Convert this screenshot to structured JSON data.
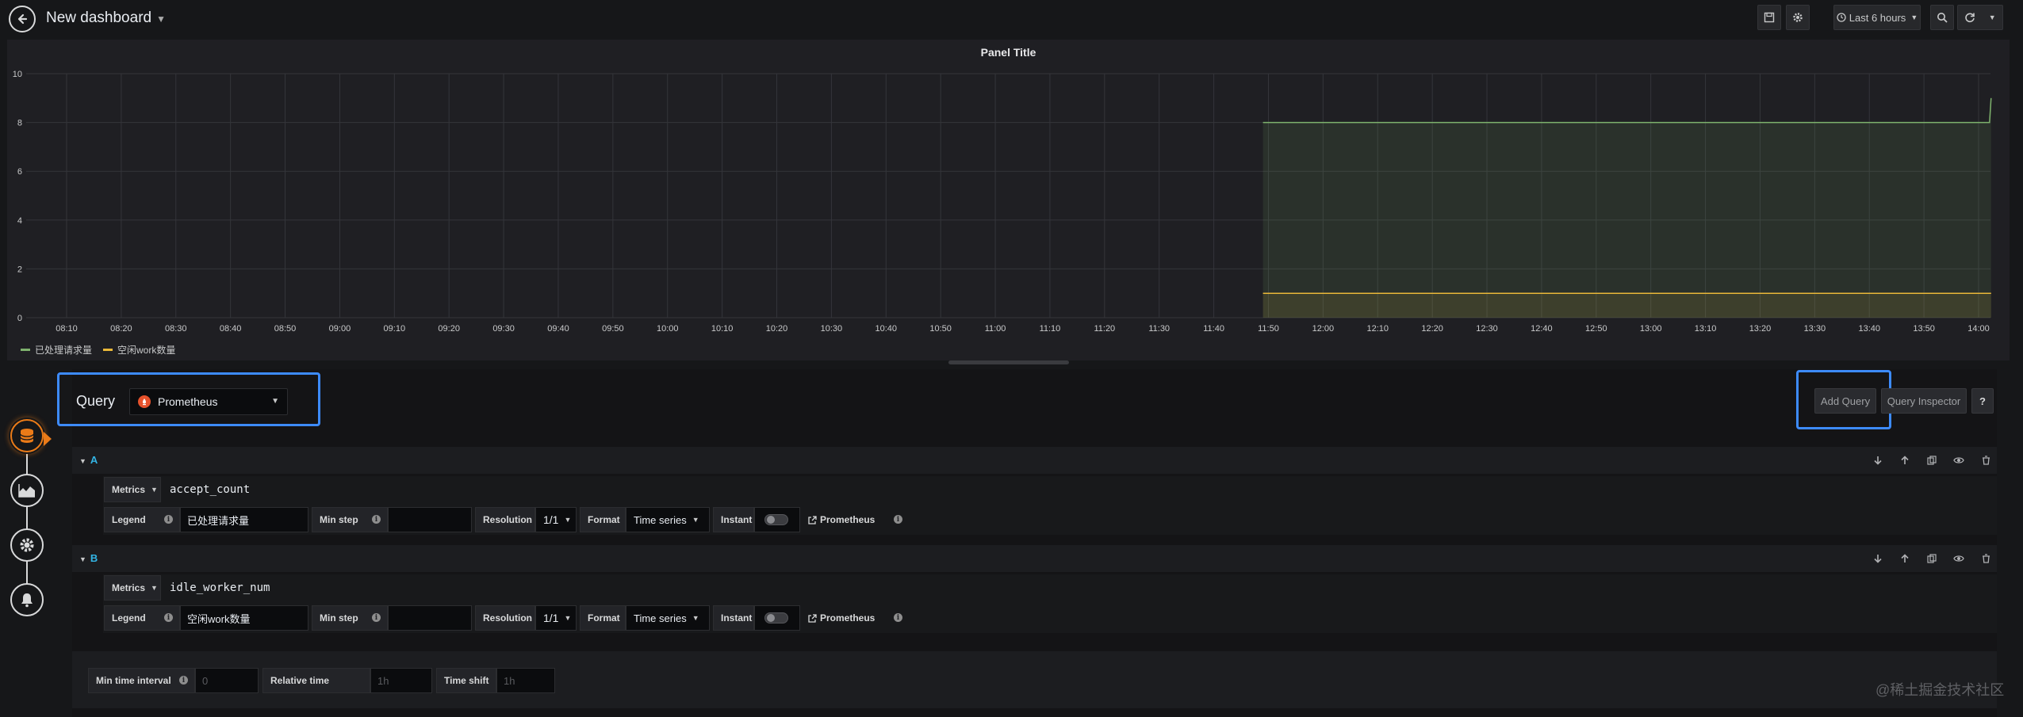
{
  "header": {
    "title": "New dashboard",
    "time_picker": "Last 6 hours"
  },
  "panel": {
    "title": "Panel Title"
  },
  "chart_data": {
    "type": "line",
    "x": [
      "08:10",
      "08:20",
      "08:30",
      "08:40",
      "08:50",
      "09:00",
      "09:10",
      "09:20",
      "09:30",
      "09:40",
      "09:50",
      "10:00",
      "10:10",
      "10:20",
      "10:30",
      "10:40",
      "10:50",
      "11:00",
      "11:10",
      "11:20",
      "11:30",
      "11:40",
      "11:50",
      "12:00",
      "12:10",
      "12:20",
      "12:30",
      "12:40",
      "12:50",
      "13:00",
      "13:10",
      "13:20",
      "13:30",
      "13:40",
      "13:50",
      "14:00"
    ],
    "ylim": [
      0,
      10
    ],
    "yticks": [
      "0",
      "2",
      "4",
      "6",
      "8",
      "10"
    ],
    "grid": true,
    "legend": "bottom-left",
    "series": [
      {
        "name": "已处理请求量",
        "color": "#7eb26d",
        "start": "11:49",
        "end": "14:02",
        "values": [
          8,
          8,
          9
        ]
      },
      {
        "name": "空闲work数量",
        "color": "#eab839",
        "start": "11:49",
        "end": "14:02",
        "values": [
          1,
          1,
          1
        ]
      }
    ]
  },
  "editor": {
    "query_label": "Query",
    "datasource": "Prometheus",
    "add_query": "Add Query",
    "query_inspector": "Query Inspector",
    "help": "?",
    "queries": [
      {
        "ref_id": "A",
        "metrics_label": "Metrics",
        "expr": "accept_count",
        "legend_label": "Legend",
        "legend_value": "已处理请求量",
        "min_step_label": "Min step",
        "resolution_label": "Resolution",
        "resolution_value": "1/1",
        "format_label": "Format",
        "format_value": "Time series",
        "instant_label": "Instant",
        "datasource_link": "Prometheus"
      },
      {
        "ref_id": "B",
        "metrics_label": "Metrics",
        "expr": "idle_worker_num",
        "legend_label": "Legend",
        "legend_value": "空闲work数量",
        "min_step_label": "Min step",
        "resolution_label": "Resolution",
        "resolution_value": "1/1",
        "format_label": "Format",
        "format_value": "Time series",
        "instant_label": "Instant",
        "datasource_link": "Prometheus"
      }
    ],
    "options": {
      "min_interval_label": "Min time interval",
      "min_interval_placeholder": "0",
      "relative_time_label": "Relative time",
      "relative_time_placeholder": "1h",
      "time_shift_label": "Time shift",
      "time_shift_placeholder": "1h"
    }
  },
  "watermark": "@稀土掘金技术社区"
}
